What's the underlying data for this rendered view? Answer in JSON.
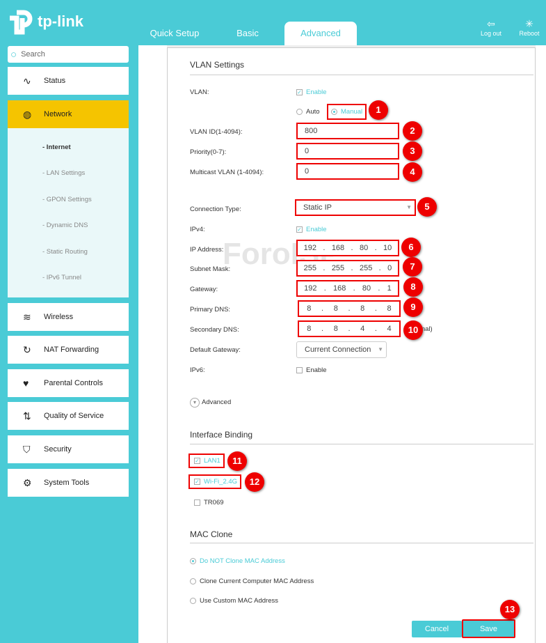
{
  "header": {
    "logo": "tp-link",
    "tabs": [
      "Quick Setup",
      "Basic",
      "Advanced"
    ],
    "logout": "Log out",
    "reboot": "Reboot"
  },
  "sidebar": {
    "search_placeholder": "Search",
    "items": [
      {
        "label": "Status",
        "icon": "pulse-icon"
      },
      {
        "label": "Network",
        "icon": "globe-icon"
      },
      {
        "label": "Wireless",
        "icon": "wifi-icon"
      },
      {
        "label": "NAT Forwarding",
        "icon": "refresh-icon"
      },
      {
        "label": "Parental Controls",
        "icon": "heart-icon"
      },
      {
        "label": "Quality of Service",
        "icon": "arrows-icon"
      },
      {
        "label": "Security",
        "icon": "shield-icon"
      },
      {
        "label": "System Tools",
        "icon": "gear-icon"
      }
    ],
    "network_sub": [
      "- Internet",
      "- LAN Settings",
      "- GPON Settings",
      "- Dynamic DNS",
      "- Static Routing",
      "- IPv6 Tunnel"
    ]
  },
  "watermark": "ForoISP",
  "vlan": {
    "title": "VLAN Settings",
    "vlan_label": "VLAN:",
    "enable": "Enable",
    "auto": "Auto",
    "manual": "Manual",
    "vlan_id_label": "VLAN ID(1-4094):",
    "vlan_id": "800",
    "priority_label": "Priority(0-7):",
    "priority": "0",
    "multicast_label": "Multicast VLAN (1-4094):",
    "multicast": "0"
  },
  "conn": {
    "type_label": "Connection Type:",
    "type": "Static IP",
    "ipv4_label": "IPv4:",
    "ipv4_enable": "Enable",
    "ip_label": "IP Address:",
    "ip": [
      "192",
      "168",
      "80",
      "10"
    ],
    "mask_label": "Subnet Mask:",
    "mask": [
      "255",
      "255",
      "255",
      "0"
    ],
    "gw_label": "Gateway:",
    "gw": [
      "192",
      "168",
      "80",
      "1"
    ],
    "dns1_label": "Primary DNS:",
    "dns1": [
      "8",
      "8",
      "8",
      "8"
    ],
    "dns2_label": "Secondary DNS:",
    "dns2": [
      "8",
      "8",
      "4",
      "4"
    ],
    "optional": "(Optional)",
    "defgw_label": "Default Gateway:",
    "defgw": "Current Connection",
    "ipv6_label": "IPv6:",
    "ipv6_enable": "Enable",
    "advanced": "Advanced"
  },
  "binding": {
    "title": "Interface Binding",
    "items": [
      "LAN1",
      "Wi-Fi_2.4G",
      "TR069"
    ]
  },
  "mac": {
    "title": "MAC Clone",
    "options": [
      "Do NOT Clone MAC Address",
      "Clone Current Computer MAC Address",
      "Use Custom MAC Address"
    ]
  },
  "buttons": {
    "cancel": "Cancel",
    "save": "Save"
  },
  "badges": [
    "1",
    "2",
    "3",
    "4",
    "5",
    "6",
    "7",
    "8",
    "9",
    "10",
    "11",
    "12",
    "13"
  ],
  "colors": {
    "accent": "#4acbd6",
    "selected": "#f5c400",
    "highlight": "#e00000"
  }
}
